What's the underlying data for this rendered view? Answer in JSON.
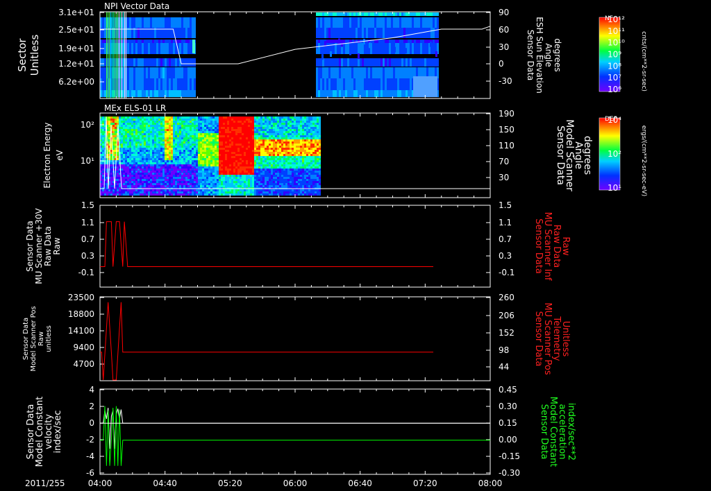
{
  "chart_data": {
    "type": "multi-panel spectrogram and line plots",
    "date_label": "2011/255",
    "x_ticks": [
      "04:00",
      "04:40",
      "05:20",
      "06:00",
      "06:40",
      "07:20",
      "08:00"
    ],
    "panels": [
      {
        "title": "NPI Vector Data",
        "type": "heatmap",
        "ylabel_left": [
          "Sector",
          "Unitless"
        ],
        "yticks_left": [
          "3.1e+01",
          "2.5e+01",
          "1.9e+01",
          "1.2e+01",
          "6.2e+00"
        ],
        "ylabel_right": [
          "Sensor Data",
          "ESH Sun Elevation",
          "Angle",
          "degrees"
        ],
        "yticks_right": [
          "90",
          "60",
          "30",
          "0",
          "-30"
        ],
        "overlay_line": {
          "color": "#ffffff",
          "times": [
            "04:00",
            "04:45",
            "04:50",
            "05:25",
            "06:00",
            "07:00",
            "07:30",
            "07:55",
            "08:00"
          ],
          "values": [
            60,
            60,
            0,
            0,
            25,
            45,
            60,
            60,
            65
          ]
        }
      },
      {
        "title": "MEx ELS-01 LR",
        "type": "heatmap",
        "ylabel_left": [
          "Electron Energy",
          "eV"
        ],
        "yticks_left": [
          "10²",
          "10¹"
        ],
        "ylabel_right": [
          "Sensor Data",
          "Model Scanner",
          "Angle",
          "degrees"
        ],
        "yticks_right": [
          "190",
          "150",
          "110",
          "70",
          "30"
        ]
      },
      {
        "type": "line",
        "ylabel_left": [
          "Sensor Data",
          "MU Scanner +30V",
          "Raw Data",
          "Raw"
        ],
        "yticks_left": [
          "1.5",
          "1.1",
          "0.7",
          "0.3",
          "-0.1"
        ],
        "ylabel_right": [
          "Sensor Data",
          "MU Scanner Inf",
          "Raw Data",
          "Raw"
        ],
        "yticks_right": [
          "1.5",
          "1.1",
          "0.7",
          "0.3",
          "-0.1"
        ],
        "series": [
          {
            "color": "#ff0000",
            "times": [
              "04:00",
              "04:03",
              "04:04",
              "04:07",
              "04:08",
              "04:10",
              "04:12",
              "04:14",
              "04:15",
              "04:17",
              "07:25"
            ],
            "values": [
              0.0,
              0.0,
              1.1,
              1.1,
              0.0,
              1.1,
              1.1,
              0.0,
              1.1,
              0.0,
              0.0
            ]
          }
        ]
      },
      {
        "type": "line",
        "ylabel_left": [
          "Sensor Data",
          "Model Scanner Pos",
          "Raw",
          "unitless"
        ],
        "yticks_left": [
          "23500",
          "18800",
          "14100",
          "9400",
          "4700"
        ],
        "ylabel_right": [
          "Sensor Data",
          "MU Scanner Pos",
          "Telemetry",
          "Unitless"
        ],
        "yticks_right": [
          "260",
          "206",
          "152",
          "98",
          "44"
        ],
        "series": [
          {
            "color": "#ff0000",
            "times": [
              "04:00",
              "04:01",
              "04:02",
              "04:05",
              "04:07",
              "04:08",
              "04:10",
              "04:13",
              "04:14",
              "04:16",
              "07:25"
            ],
            "values": [
              8000,
              8000,
              0,
              22000,
              8000,
              0,
              0,
              22000,
              8000,
              8000,
              8000
            ]
          }
        ]
      },
      {
        "type": "line",
        "ylabel_left": [
          "Sensor Data",
          "Model Constant",
          "velocity",
          "index/sec"
        ],
        "yticks_left": [
          "4",
          "2",
          "0",
          "-2",
          "-4",
          "-6"
        ],
        "ylabel_right": [
          "Sensor Data",
          "Model Constant",
          "acceleration",
          "index/sec**2"
        ],
        "yticks_right": [
          "0.45",
          "0.30",
          "0.15",
          "0.00",
          "-0.15",
          "-0.30"
        ],
        "series": [
          {
            "color": "#ffffff",
            "times": [
              "04:00",
              "04:02",
              "04:03",
              "04:04",
              "04:05",
              "04:06",
              "04:07",
              "04:08",
              "04:09",
              "04:10",
              "04:11",
              "04:12",
              "04:13",
              "04:14",
              "04:15",
              "08:00"
            ],
            "values": [
              0,
              0,
              1.5,
              0.5,
              1.8,
              -3,
              0.8,
              1.5,
              -3,
              1,
              1.7,
              0.5,
              1.6,
              0,
              0,
              0
            ]
          },
          {
            "color": "#00ff00",
            "times": [
              "04:00",
              "04:02",
              "04:03",
              "04:04",
              "04:05",
              "04:06",
              "04:07",
              "04:08",
              "04:09",
              "04:10",
              "04:11",
              "04:12",
              "04:13",
              "04:14",
              "04:15",
              "08:00"
            ],
            "values": [
              -2,
              -2,
              2,
              -5,
              1.5,
              -5,
              -2,
              1.8,
              -5,
              2,
              -5,
              1.6,
              -5,
              -2,
              -2,
              -2
            ]
          }
        ]
      }
    ],
    "colorbars": [
      {
        "label": "NF",
        "unit": "cnts/(cm**2-sr-sec)",
        "ticks": [
          "10¹²",
          "10¹¹",
          "10¹⁰",
          "10⁹",
          "10⁸",
          "10⁷",
          "10⁶"
        ]
      },
      {
        "label": "DEF",
        "unit": "ergs/(cm**2-sr-sec-eV)",
        "ticks": [
          "10⁴",
          "10²",
          "10¹"
        ]
      }
    ]
  }
}
